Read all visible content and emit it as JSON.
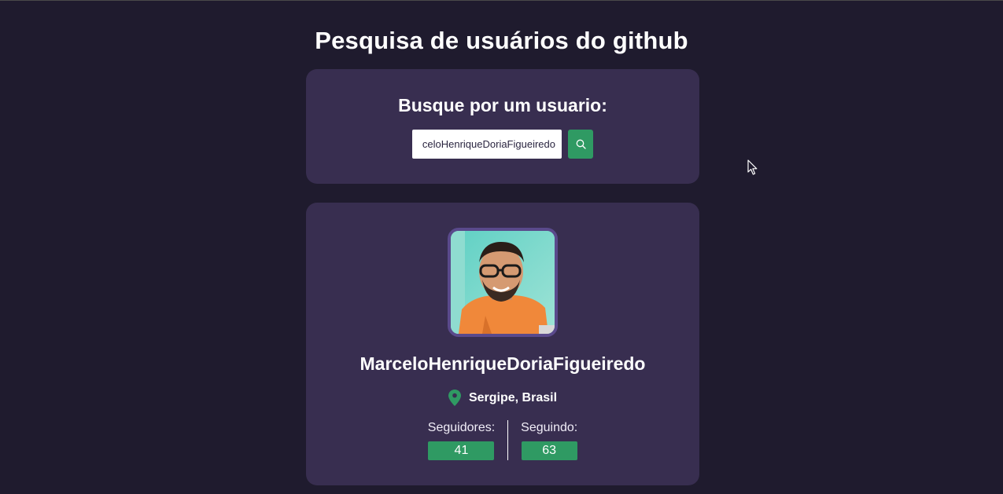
{
  "page": {
    "title": "Pesquisa de usuários do github"
  },
  "search": {
    "heading": "Busque por um usuario:",
    "input_value": "celoHenriqueDoriaFigueiredo",
    "button_icon": "search-icon"
  },
  "profile": {
    "avatar_icon": "avatar",
    "name": "MarceloHenriqueDoriaFigueiredo",
    "location_icon": "map-pin-icon",
    "location": "Sergipe, Brasil",
    "followers_label": "Seguidores:",
    "followers_count": "41",
    "following_label": "Seguindo:",
    "following_count": "63"
  },
  "colors": {
    "background": "#1f1b2e",
    "card": "#382e50",
    "accent": "#2f9a63",
    "avatar_border": "#5a4a8c"
  }
}
